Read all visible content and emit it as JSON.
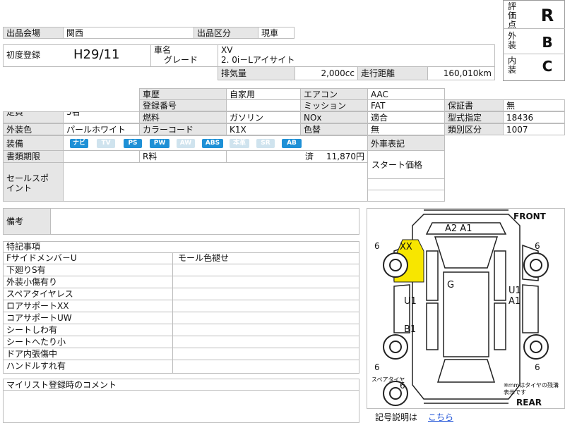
{
  "header": {
    "auction_site_label": "出品会場",
    "auction_site_value": "関西",
    "listing_type_label": "出品区分",
    "listing_type_value": "現車"
  },
  "vehicle": {
    "first_reg_label": "初度登録",
    "first_reg_value": "H29/11",
    "name_label": "車名",
    "grade_label": "グレード",
    "name_value": "XV",
    "grade_value": "2. 0i－Lアイサイト",
    "displacement_label": "排気量",
    "displacement_value": "2,000cc",
    "mileage_label": "走行距離",
    "mileage_value": "160,010km"
  },
  "grades": {
    "overall_label": "評価点",
    "overall_value": "R",
    "exterior_label": "外装",
    "exterior_value": "B",
    "interior_label": "内装",
    "interior_value": "C"
  },
  "specs": {
    "history_label": "車歴",
    "history_value": "自家用",
    "ac_label": "エアコン",
    "ac_value": "AAC",
    "plate_label": "登録番号",
    "plate_value": "",
    "mission_label": "ミッション",
    "mission_value": "FAT",
    "warranty_label": "保証書",
    "warranty_value": "無",
    "capacity_label": "定員",
    "capacity_value": "5名",
    "fuel_label": "燃料",
    "fuel_value": "ガソリン",
    "nox_label": "NOx",
    "nox_value": "適合",
    "model_cert_label": "型式指定",
    "model_cert_value": "18436",
    "color_label": "外装色",
    "color_value": "パールホワイト",
    "color_code_label": "カラーコード",
    "color_code_value": "K1X",
    "repaint_label": "色替",
    "repaint_value": "無",
    "class_label": "類別区分",
    "class_value": "1007",
    "equipment_label": "装備",
    "equipment": [
      {
        "name": "ナビ",
        "on": true
      },
      {
        "name": "TV",
        "on": false
      },
      {
        "name": "PS",
        "on": true
      },
      {
        "name": "PW",
        "on": true
      },
      {
        "name": "AW",
        "on": false
      },
      {
        "name": "ABS",
        "on": true
      },
      {
        "name": "本革",
        "on": false
      },
      {
        "name": "SR",
        "on": false
      },
      {
        "name": "AB",
        "on": true
      }
    ],
    "import_label": "外車表記",
    "docs_label": "書類期限",
    "recycle_label": "R料",
    "recycle_status": "済",
    "recycle_value": "11,870円",
    "start_price_label": "スタート価格",
    "sales_point_label": "セールスポイント"
  },
  "remarks": {
    "label": "備考"
  },
  "notes": {
    "title": "特記事項",
    "rows": [
      [
        "Fサイドメンバ－U",
        "モール色褪せ"
      ],
      [
        "下廻りS有",
        ""
      ],
      [
        "外装小傷有り",
        ""
      ],
      [
        "スペアタイヤレス",
        ""
      ],
      [
        "ロアサポートXX",
        ""
      ],
      [
        "コアサポートUW",
        ""
      ],
      [
        "シートしわ有",
        ""
      ],
      [
        "シートへたり小",
        ""
      ],
      [
        "ドア内張傷中",
        ""
      ],
      [
        "ハンドルすれ有",
        ""
      ]
    ]
  },
  "mylist_comment_label": "マイリスト登録時のコメント",
  "diagram": {
    "front": "FRONT",
    "rear": "REAR",
    "tire_fl": "6",
    "tire_fr": "6",
    "tire_rl": "6",
    "tire_rr": "6",
    "tire_spare": "6",
    "spare_label": "スペアタイヤ",
    "mark_hood": "A2 A1",
    "mark_fender": "XX",
    "mark_roof": "G",
    "mark_left_door": "U1",
    "mark_left_rear": "B1",
    "mark_right_1": "U1",
    "mark_right_2": "A1",
    "tire_note": "※mmはタイヤの残溝表示です",
    "legend_text": "記号説明は",
    "legend_link": "こちら",
    "highlight_color": "#f7e600"
  }
}
